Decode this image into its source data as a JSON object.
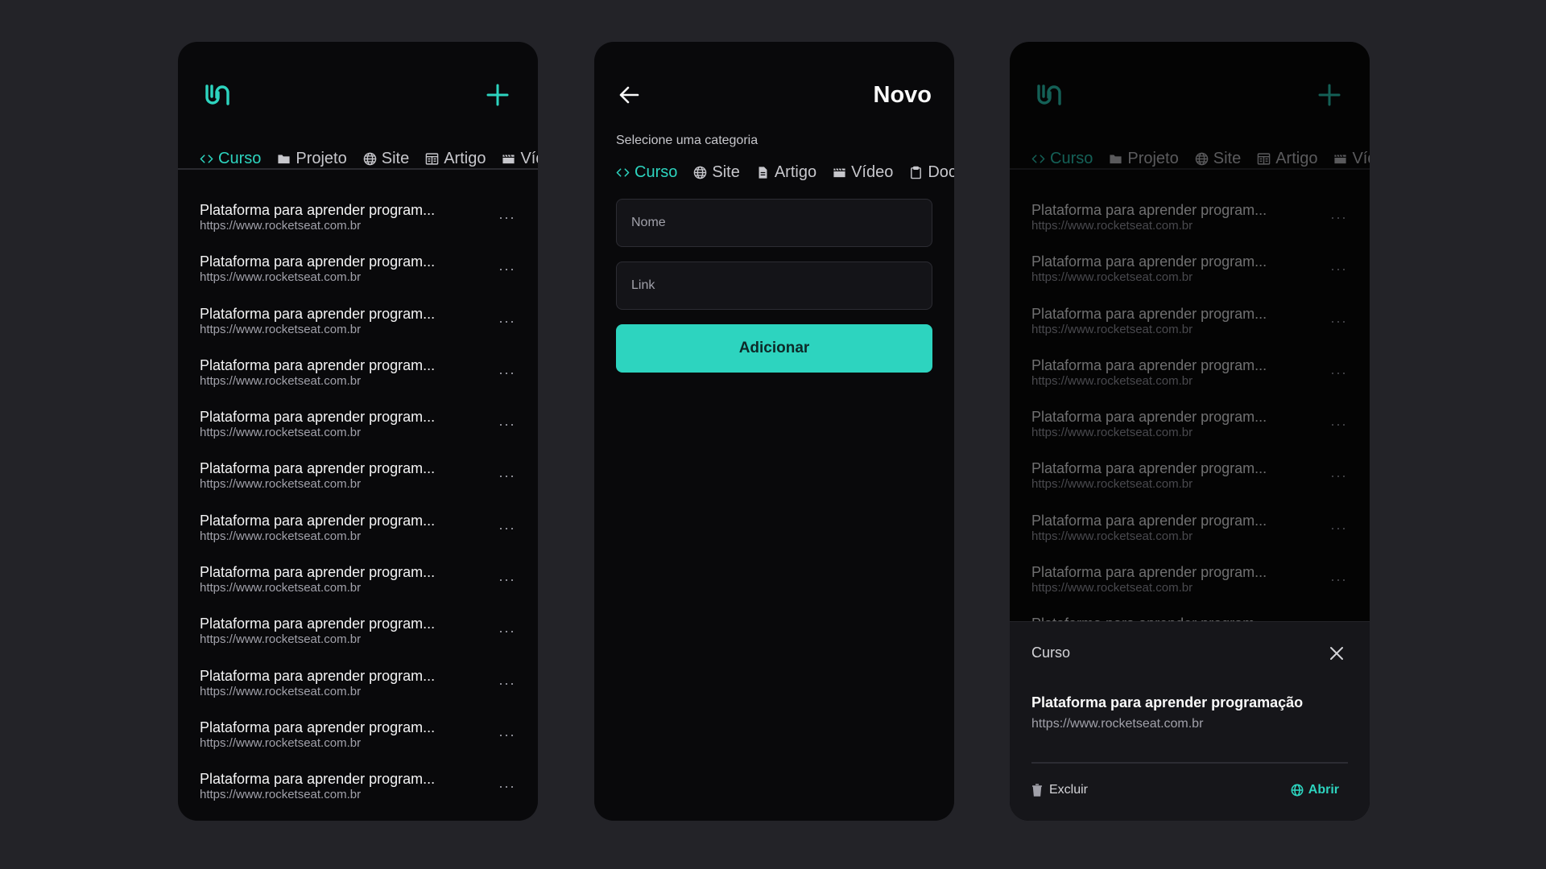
{
  "categories": [
    {
      "label": "Curso",
      "icon": "code-icon"
    },
    {
      "label": "Projeto",
      "icon": "folder-icon"
    },
    {
      "label": "Site",
      "icon": "globe-icon"
    },
    {
      "label": "Artigo",
      "icon": "newspaper-icon"
    },
    {
      "label": "Vídeo",
      "icon": "clapper-icon"
    }
  ],
  "form_categories": [
    {
      "label": "Curso",
      "icon": "code-icon"
    },
    {
      "label": "Site",
      "icon": "globe-icon"
    },
    {
      "label": "Artigo",
      "icon": "document-icon"
    },
    {
      "label": "Vídeo",
      "icon": "clapper-icon"
    },
    {
      "label": "Documentação",
      "icon": "clipboard-icon"
    }
  ],
  "list_items": [
    {
      "title": "Plataforma para aprender program...",
      "url": "https://www.rocketseat.com.br"
    },
    {
      "title": "Plataforma para aprender program...",
      "url": "https://www.rocketseat.com.br"
    },
    {
      "title": "Plataforma para aprender program...",
      "url": "https://www.rocketseat.com.br"
    },
    {
      "title": "Plataforma para aprender program...",
      "url": "https://www.rocketseat.com.br"
    },
    {
      "title": "Plataforma para aprender program...",
      "url": "https://www.rocketseat.com.br"
    },
    {
      "title": "Plataforma para aprender program...",
      "url": "https://www.rocketseat.com.br"
    },
    {
      "title": "Plataforma para aprender program...",
      "url": "https://www.rocketseat.com.br"
    },
    {
      "title": "Plataforma para aprender program...",
      "url": "https://www.rocketseat.com.br"
    },
    {
      "title": "Plataforma para aprender program...",
      "url": "https://www.rocketseat.com.br"
    },
    {
      "title": "Plataforma para aprender program...",
      "url": "https://www.rocketseat.com.br"
    },
    {
      "title": "Plataforma para aprender program...",
      "url": "https://www.rocketseat.com.br"
    },
    {
      "title": "Plataforma para aprender program...",
      "url": "https://www.rocketseat.com.br"
    }
  ],
  "more_glyph": "···",
  "form": {
    "title": "Novo",
    "select_label": "Selecione uma categoria",
    "name_placeholder": "Nome",
    "link_placeholder": "Link",
    "submit_label": "Adicionar"
  },
  "sheet": {
    "category": "Curso",
    "title": "Plataforma para aprender programação",
    "url": "https://www.rocketseat.com.br",
    "delete_label": "Excluir",
    "open_label": "Abrir"
  },
  "colors": {
    "accent": "#2dd4bf",
    "background": "#232328",
    "panel": "#09090b"
  }
}
